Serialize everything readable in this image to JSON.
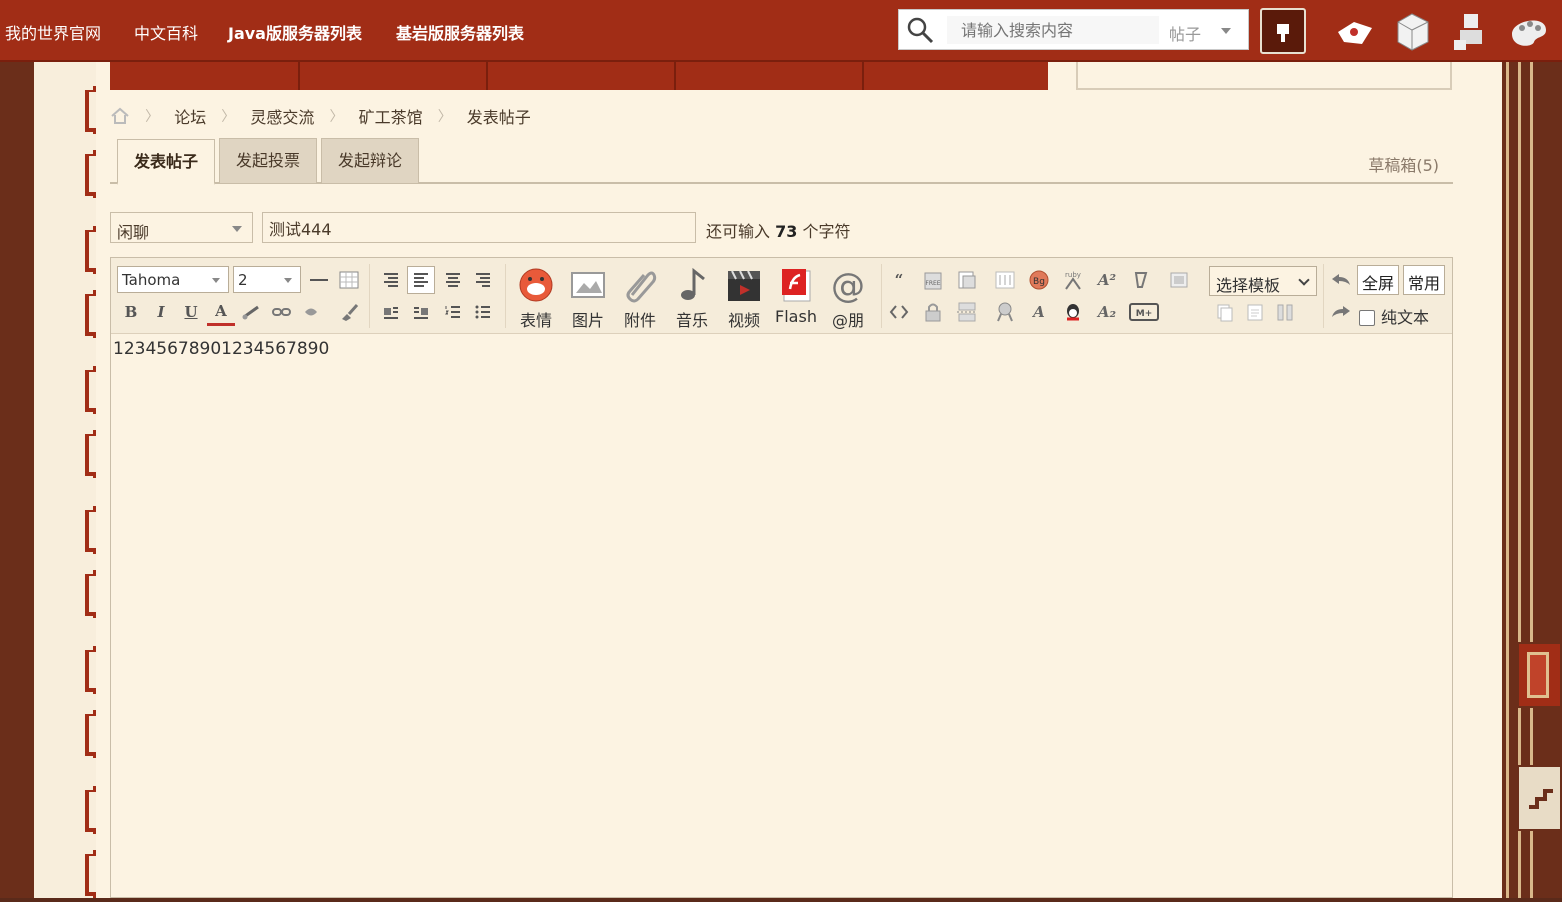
{
  "topnav": {
    "links": [
      "我的世界官网",
      "中文百科",
      "Java版服务器列表",
      "基岩版服务器列表"
    ],
    "search_placeholder": "请输入搜索内容",
    "search_type": "帖子"
  },
  "breadcrumb": [
    "论坛",
    "灵感交流",
    "矿工茶馆",
    "发表帖子"
  ],
  "tabs": [
    "发表帖子",
    "发起投票",
    "发起辩论"
  ],
  "drafts": "草稿箱(5)",
  "form": {
    "type_value": "闲聊",
    "title_value": "测试444",
    "remain_prefix": "还可输入",
    "remain_count": "73",
    "remain_suffix": "个字符"
  },
  "toolbar": {
    "font": "Tahoma",
    "size": "2",
    "big_buttons": [
      "表情",
      "图片",
      "附件",
      "音乐",
      "视频",
      "Flash",
      "@朋"
    ],
    "template": "选择模板",
    "fullscreen": "全屏",
    "common": "常用",
    "plain_text": "纯文本"
  },
  "editor": {
    "content": "12345678901234567890"
  },
  "colors": {
    "header_red": "#a12d16",
    "frame_brown": "#6b2e1a",
    "paper": "#fcf3e2"
  }
}
